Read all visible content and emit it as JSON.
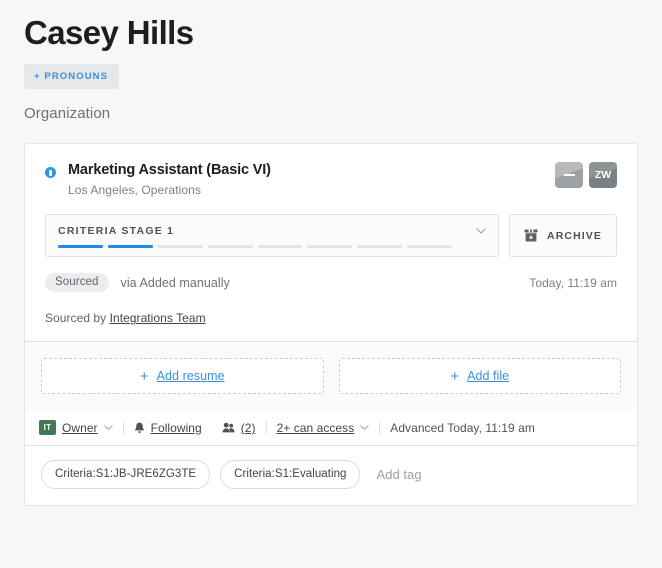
{
  "header": {
    "name": "Casey Hills",
    "pronouns_button": "+ PRONOUNS",
    "organization_label": "Organization"
  },
  "card": {
    "job": {
      "title": "Marketing Assistant (Basic VI)",
      "subtitle": "Los Angeles, Operations",
      "status_icon": "job-status-dot"
    },
    "avatars": [
      {
        "name": "avatar-placeholder",
        "label": ""
      },
      {
        "name": "avatar-initials",
        "label": "ZW"
      }
    ],
    "stage": {
      "label": "CRITERIA STAGE 1",
      "total_segments": 8,
      "completed_segments": 2,
      "caret_icon": "chevron-down-icon"
    },
    "archive": {
      "label": "ARCHIVE",
      "icon": "archive-box-icon"
    },
    "sourced": {
      "chip": "Sourced",
      "via": "via Added manually",
      "timestamp": "Today, 11:19 am",
      "by_prefix": "Sourced by",
      "by_link": "Integrations Team"
    },
    "attachments": [
      {
        "plus": "+",
        "label": "Add resume",
        "name": "add-resume"
      },
      {
        "plus": "+",
        "label": "Add file",
        "name": "add-file"
      }
    ],
    "meta": {
      "owner_initials": "IT",
      "owner_label": "Owner",
      "following_label": "Following",
      "followers_count": "(2)",
      "access_label": "2+ can access",
      "advanced_text": "Advanced Today, 11:19 am"
    },
    "tags": {
      "items": [
        "Criteria:S1:JB-JRE6ZG3TE",
        "Criteria:S1:Evaluating"
      ],
      "add_placeholder": "Add tag"
    }
  },
  "colors": {
    "accent_blue": "#1f8ceb",
    "link_blue": "#3b8ede",
    "owner_green": "#3f7a52",
    "page_bg": "#f7f7f7"
  }
}
